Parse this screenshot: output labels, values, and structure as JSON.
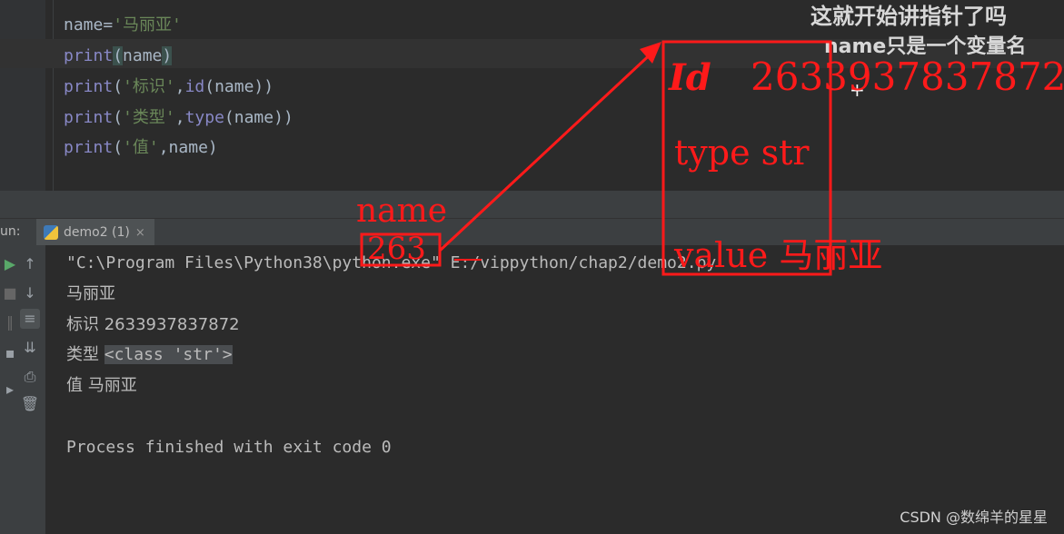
{
  "overlay": {
    "line1": "这就开始讲指针了吗",
    "line2": "name只是一个变量名"
  },
  "editor": {
    "lines": [
      {
        "var": "name",
        "eq": "=",
        "str": "'马丽亚'"
      },
      {
        "fn": "print",
        "open": "(",
        "arg": "name",
        "close": ")"
      },
      {
        "fn": "print",
        "open": "(",
        "str": "'标识'",
        "comma": ",",
        "fn2": "id",
        "rest": "(name))"
      },
      {
        "fn": "print",
        "open": "(",
        "str": "'类型'",
        "comma": ",",
        "fn2": "type",
        "rest": "(name))"
      },
      {
        "fn": "print",
        "open": "(",
        "str": "'值'",
        "rest": ",name)"
      }
    ]
  },
  "run_panel": {
    "label": "un:",
    "tab_label": "demo2 (1)",
    "tab_close": "×"
  },
  "console": {
    "cmd": "\"C:\\Program Files\\Python38\\python.exe\" E:/vippython/chap2/demo2.py",
    "out1": "马丽亚",
    "out2": "标识 2633937837872",
    "out3_prefix": "类型 ",
    "out3_class": "<class 'str'>",
    "out4": "值 马丽亚",
    "finish": "Process finished with exit code 0"
  },
  "annotations": {
    "name_label": "name",
    "box_value": "263",
    "id_label": "Id",
    "id_value": "2633937837872",
    "type_line": "type str",
    "value_line": "value 马丽亚",
    "color": "#ff1a1a"
  },
  "watermark": "CSDN @数绵羊的星星"
}
